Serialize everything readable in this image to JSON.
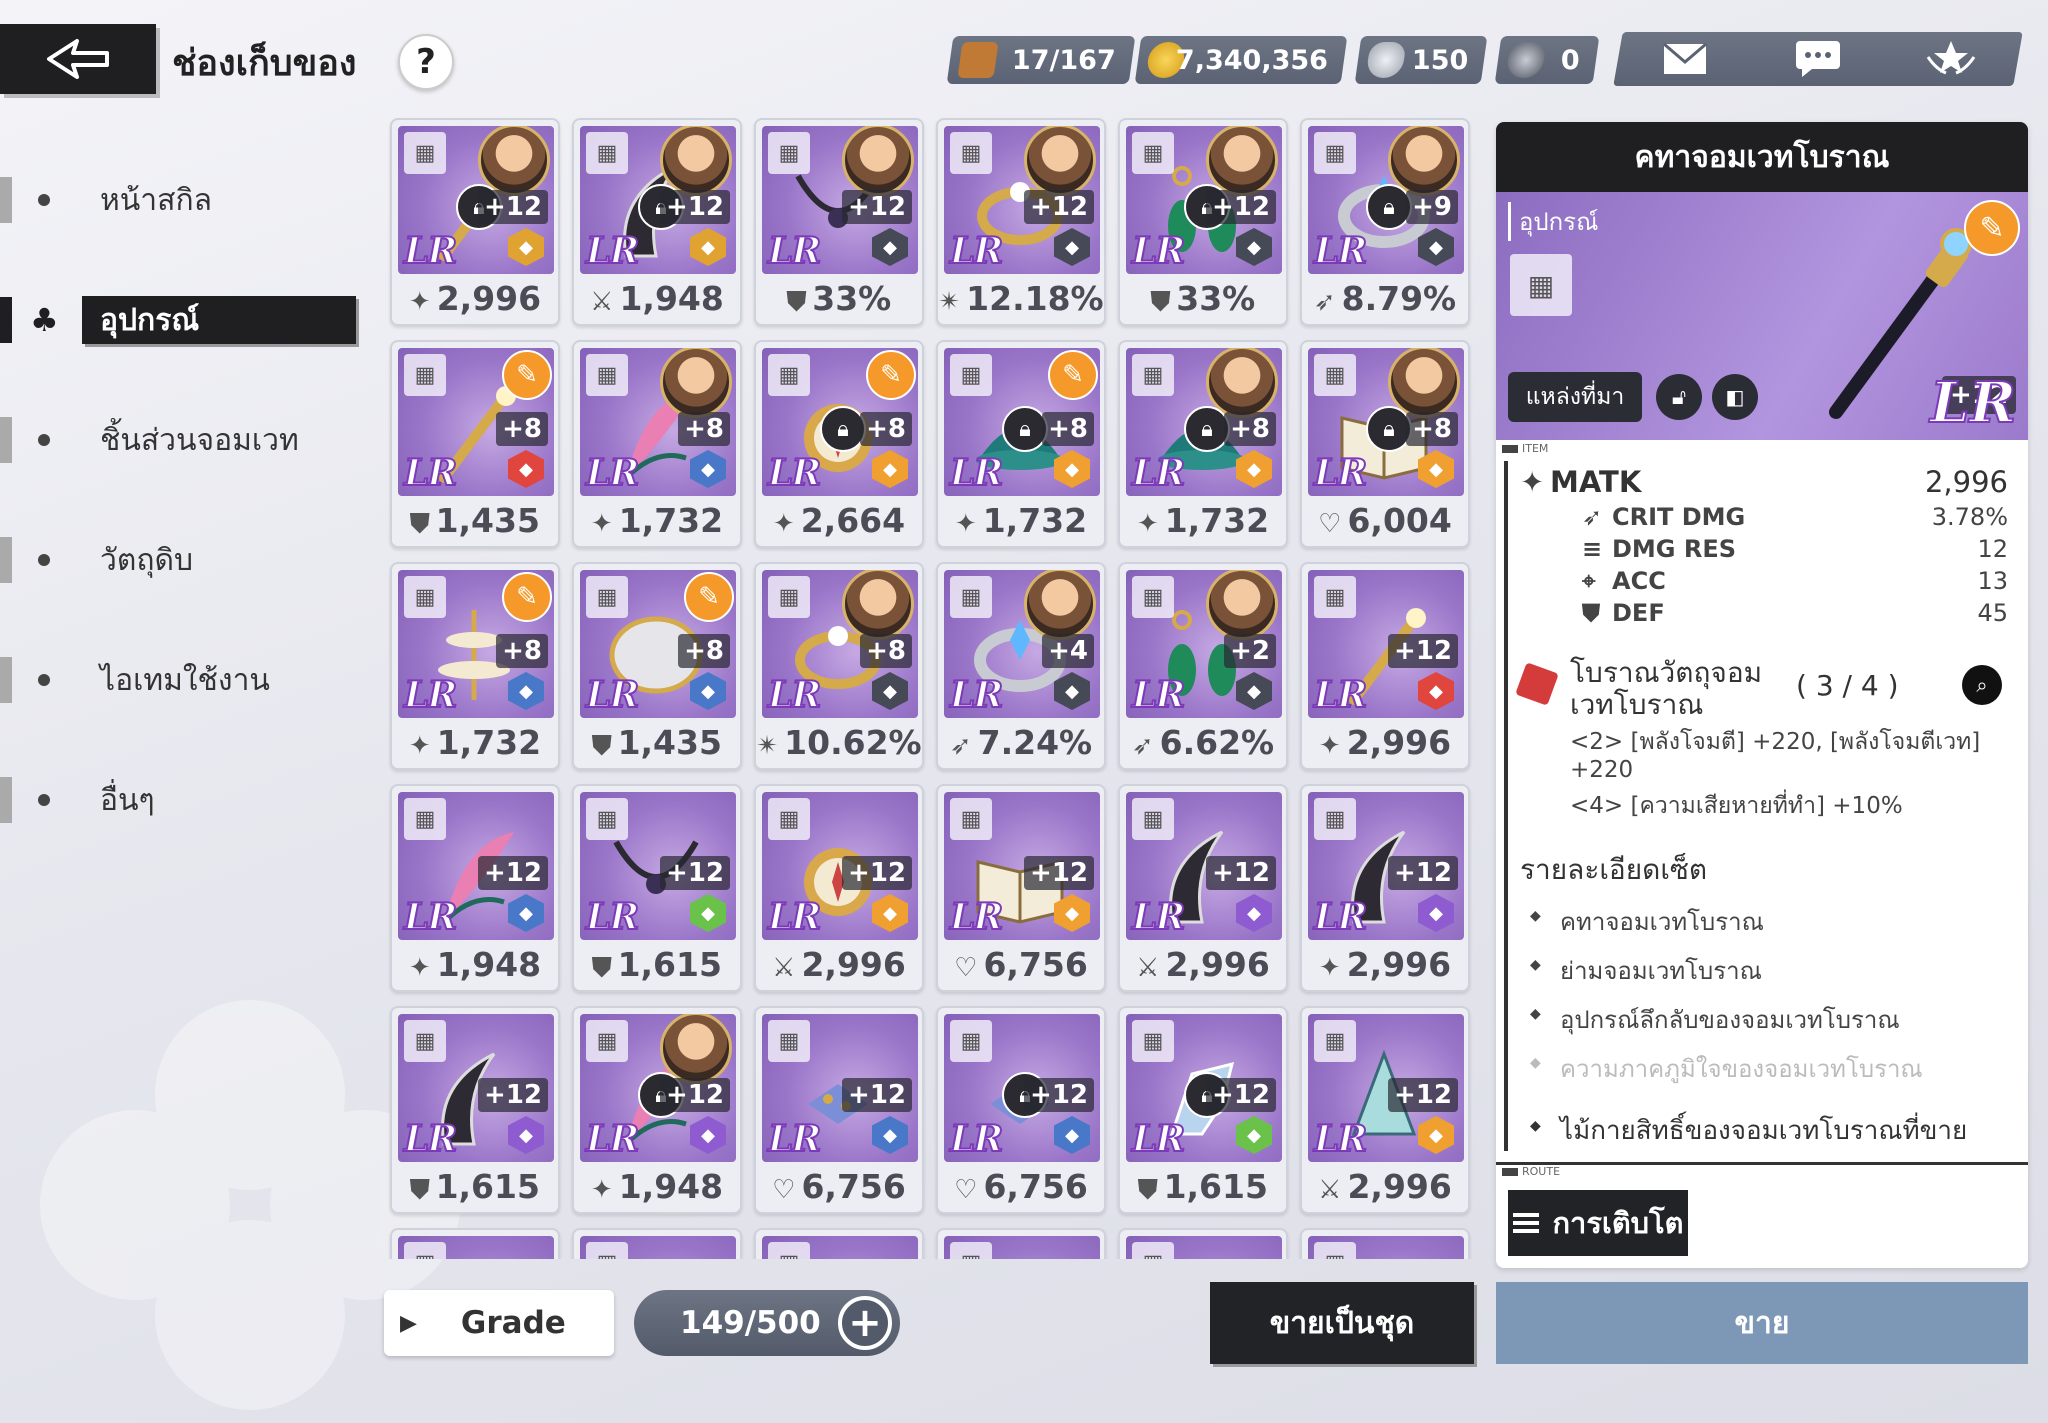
{
  "header": {
    "title": "ช่องเก็บของ",
    "help_label": "?",
    "resources": [
      {
        "name": "boot-icon",
        "value": "17/167",
        "color": "#c07a35"
      },
      {
        "name": "gold-coin-icon",
        "value": "7,340,356",
        "color": "#e2b12a"
      },
      {
        "name": "silver-crystal-icon",
        "value": "150",
        "color": "#b9bec8"
      },
      {
        "name": "dark-crystal-icon",
        "value": "0",
        "color": "#6b7180"
      }
    ],
    "icons": [
      "mail-icon",
      "chat-icon",
      "crest-icon"
    ]
  },
  "sidebar": {
    "items": [
      {
        "label": "หน้าสกิล",
        "active": false
      },
      {
        "label": "อุปกรณ์",
        "active": true
      },
      {
        "label": "ชิ้นส่วนจอมเวท",
        "active": false
      },
      {
        "label": "วัตถุดิบ",
        "active": false
      },
      {
        "label": "ไอเทมใช้งาน",
        "active": false
      },
      {
        "label": "อื่นๆ",
        "active": false
      }
    ]
  },
  "grid": {
    "rank_label": "LR",
    "cards": [
      {
        "level": "+12",
        "stat": "2,996",
        "stat_icon": "sparkle-icon",
        "locked": true,
        "pin": false,
        "portrait": true,
        "type_color": "#e0a332",
        "item": "staff"
      },
      {
        "level": "+12",
        "stat": "1,948",
        "stat_icon": "sword-icon",
        "locked": true,
        "pin": false,
        "portrait": true,
        "type_color": "#e0a332",
        "item": "horn"
      },
      {
        "level": "+12",
        "stat": "33%",
        "stat_icon": "shield-icon",
        "locked": false,
        "pin": false,
        "portrait": true,
        "type_color": "#454a56",
        "item": "necklace"
      },
      {
        "level": "+12",
        "stat": "12.18%",
        "stat_icon": "crit-icon",
        "locked": false,
        "pin": false,
        "portrait": true,
        "type_color": "#454a56",
        "item": "ring"
      },
      {
        "level": "+12",
        "stat": "33%",
        "stat_icon": "shield-icon",
        "locked": true,
        "pin": false,
        "portrait": true,
        "type_color": "#454a56",
        "item": "earring"
      },
      {
        "level": "+9",
        "stat": "8.79%",
        "stat_icon": "critdmg-icon",
        "locked": true,
        "pin": false,
        "portrait": true,
        "type_color": "#454a56",
        "item": "bracelet"
      },
      {
        "level": "+8",
        "stat": "1,435",
        "stat_icon": "shield-icon",
        "locked": false,
        "pin": true,
        "portrait": false,
        "type_color": "#e0463d",
        "item": "staff"
      },
      {
        "level": "+8",
        "stat": "1,732",
        "stat_icon": "sparkle-icon",
        "locked": false,
        "pin": false,
        "portrait": true,
        "type_color": "#4a78c8",
        "item": "feather"
      },
      {
        "level": "+8",
        "stat": "2,664",
        "stat_icon": "sparkle-icon",
        "locked": true,
        "pin": true,
        "portrait": false,
        "type_color": "#f0a030",
        "item": "compass"
      },
      {
        "level": "+8",
        "stat": "1,732",
        "stat_icon": "sparkle-icon",
        "locked": true,
        "pin": true,
        "portrait": false,
        "type_color": "#f0a030",
        "item": "hat"
      },
      {
        "level": "+8",
        "stat": "1,732",
        "stat_icon": "sparkle-icon",
        "locked": true,
        "pin": false,
        "portrait": true,
        "type_color": "#f0a030",
        "item": "hat"
      },
      {
        "level": "+8",
        "stat": "6,004",
        "stat_icon": "heart-icon",
        "locked": true,
        "pin": false,
        "portrait": true,
        "type_color": "#f0a030",
        "item": "book"
      },
      {
        "level": "+8",
        "stat": "1,732",
        "stat_icon": "sparkle-icon",
        "locked": false,
        "pin": true,
        "portrait": false,
        "type_color": "#4a78c8",
        "item": "stand"
      },
      {
        "level": "+8",
        "stat": "1,435",
        "stat_icon": "shield-icon",
        "locked": false,
        "pin": true,
        "portrait": false,
        "type_color": "#4a78c8",
        "item": "mirror"
      },
      {
        "level": "+8",
        "stat": "10.62%",
        "stat_icon": "crit-icon",
        "locked": false,
        "pin": false,
        "portrait": true,
        "type_color": "#454a56",
        "item": "ring"
      },
      {
        "level": "+4",
        "stat": "7.24%",
        "stat_icon": "critdmg-icon",
        "locked": false,
        "pin": false,
        "portrait": true,
        "type_color": "#454a56",
        "item": "bracelet"
      },
      {
        "level": "+2",
        "stat": "6.62%",
        "stat_icon": "critdmg-icon",
        "locked": false,
        "pin": false,
        "portrait": true,
        "type_color": "#454a56",
        "item": "earring"
      },
      {
        "level": "+12",
        "stat": "2,996",
        "stat_icon": "sparkle-icon",
        "locked": false,
        "pin": false,
        "portrait": false,
        "type_color": "#e0463d",
        "item": "staff"
      },
      {
        "level": "+12",
        "stat": "1,948",
        "stat_icon": "sparkle-icon",
        "locked": false,
        "pin": false,
        "portrait": false,
        "type_color": "#4a78c8",
        "item": "feather"
      },
      {
        "level": "+12",
        "stat": "1,615",
        "stat_icon": "shield-icon",
        "locked": false,
        "pin": false,
        "portrait": false,
        "type_color": "#6ac24a",
        "item": "necklace"
      },
      {
        "level": "+12",
        "stat": "2,996",
        "stat_icon": "sword-icon",
        "locked": false,
        "pin": false,
        "portrait": false,
        "type_color": "#f0a030",
        "item": "compass"
      },
      {
        "level": "+12",
        "stat": "6,756",
        "stat_icon": "heart-icon",
        "locked": false,
        "pin": false,
        "portrait": false,
        "type_color": "#f0a030",
        "item": "book"
      },
      {
        "level": "+12",
        "stat": "2,996",
        "stat_icon": "sword-icon",
        "locked": false,
        "pin": false,
        "portrait": false,
        "type_color": "#8e5cd0",
        "item": "horn"
      },
      {
        "level": "+12",
        "stat": "2,996",
        "stat_icon": "sparkle-icon",
        "locked": false,
        "pin": false,
        "portrait": false,
        "type_color": "#8e5cd0",
        "item": "horn"
      },
      {
        "level": "+12",
        "stat": "1,615",
        "stat_icon": "shield-icon",
        "locked": false,
        "pin": false,
        "portrait": false,
        "type_color": "#8e5cd0",
        "item": "horn"
      },
      {
        "level": "+12",
        "stat": "1,948",
        "stat_icon": "sparkle-icon",
        "locked": true,
        "pin": false,
        "portrait": true,
        "type_color": "#8e5cd0",
        "item": "feather"
      },
      {
        "level": "+12",
        "stat": "6,756",
        "stat_icon": "heart-icon",
        "locked": false,
        "pin": false,
        "portrait": false,
        "type_color": "#4a78c8",
        "item": "pendant"
      },
      {
        "level": "+12",
        "stat": "6,756",
        "stat_icon": "heart-icon",
        "locked": true,
        "pin": false,
        "portrait": false,
        "type_color": "#4a78c8",
        "item": "pendant"
      },
      {
        "level": "+12",
        "stat": "1,615",
        "stat_icon": "shield-icon",
        "locked": true,
        "pin": false,
        "portrait": false,
        "type_color": "#6ac24a",
        "item": "glove"
      },
      {
        "level": "+12",
        "stat": "2,996",
        "stat_icon": "sword-icon",
        "locked": false,
        "pin": false,
        "portrait": false,
        "type_color": "#f0a030",
        "item": "shell"
      }
    ]
  },
  "bottom": {
    "grade_label": "Grade",
    "capacity": "149/500",
    "sell_set_label": "ขายเป็นชุด",
    "sell_label": "ขาย"
  },
  "detail": {
    "title": "คทาจอมเวทโบราณ",
    "category": "อุปกรณ์",
    "source_label": "แหล่งที่มา",
    "level": "+12",
    "rank": "LR",
    "item_tag": "ITEM",
    "main_stat": {
      "name": "MATK",
      "value": "2,996"
    },
    "sub_stats": [
      {
        "name": "CRIT DMG",
        "value": "3.78%",
        "icon": "critdmg-icon"
      },
      {
        "name": "DMG RES",
        "value": "12",
        "icon": "dmgres-icon"
      },
      {
        "name": "ACC",
        "value": "13",
        "icon": "target-icon"
      },
      {
        "name": "DEF",
        "value": "45",
        "icon": "shield-icon"
      }
    ],
    "set_name": "โบราณวัตถุจอมเวทโบราณ",
    "set_count": "( 3 / 4 )",
    "set_effects": [
      "<2> [พลังโจมตี] +220, [พลังโจมตีเวท] +220",
      "<4> [ความเสียหายที่ทำ] +10%"
    ],
    "set_detail_title": "รายละเอียดเซ็ต",
    "set_pieces": [
      {
        "name": "คทาจอมเวทโบราณ",
        "owned": true
      },
      {
        "name": "ย่ามจอมเวทโบราณ",
        "owned": true
      },
      {
        "name": "อุปกรณ์ลึกลับของจอมเวทโบราณ",
        "owned": true
      },
      {
        "name": "ความภาคภูมิใจของจอมเวทโบราณ",
        "owned": false
      }
    ],
    "route_item": "ไม้กายสิทธิ์ของจอมเวทโบราณที่ขาย",
    "route_tag": "ROUTE",
    "growth_label": "การเติบโต"
  }
}
